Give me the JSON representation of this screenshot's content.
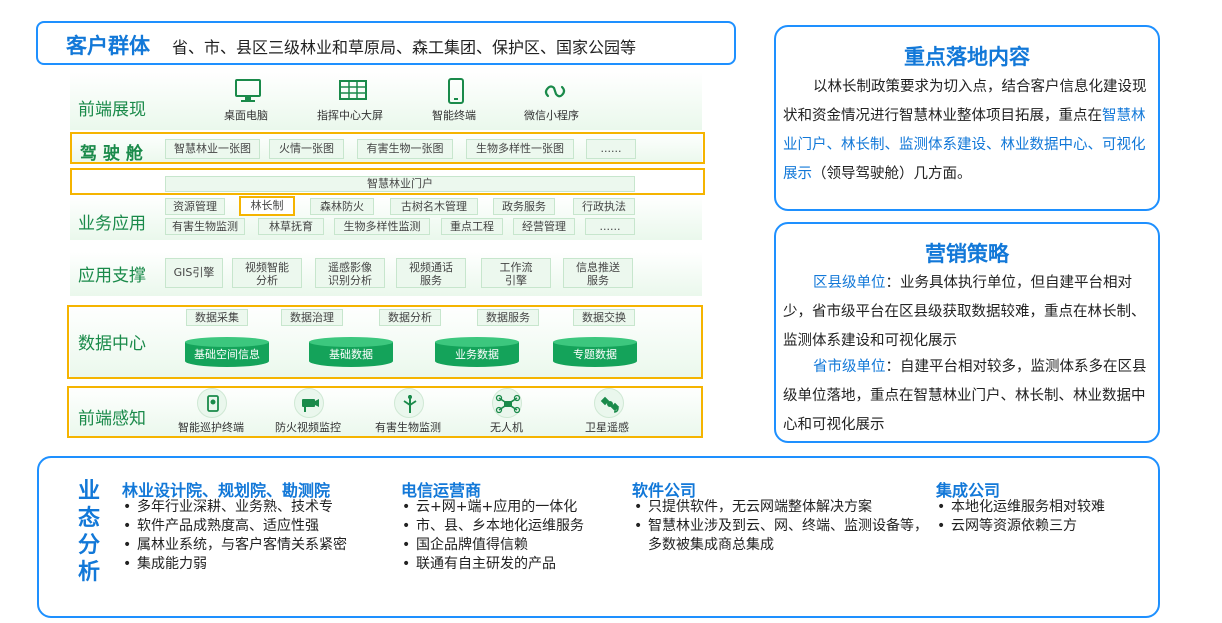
{
  "customer": {
    "title": "客户群体",
    "text": "省、市、县区三级林业和草原局、森工集团、保护区、国家公园等"
  },
  "layers": {
    "frontend_display": {
      "label": "前端展现",
      "items": [
        "桌面电脑",
        "指挥中心大屏",
        "智能终端",
        "微信小程序"
      ],
      "icons": [
        "monitor-icon",
        "big-screen-icon",
        "tablet-icon",
        "wechat-miniprogram-icon"
      ]
    },
    "cockpit": {
      "label": "驾 驶 舱",
      "items": [
        "智慧林业一张图",
        "火情一张图",
        "有害生物一张图",
        "生物多样性一张图",
        "......"
      ]
    },
    "portal": {
      "label": "智慧林业门户"
    },
    "business": {
      "label": "业务应用",
      "row1": [
        "资源管理",
        "林长制",
        "森林防火",
        "古树名木管理",
        "政务服务",
        "行政执法"
      ],
      "row2": [
        "有害生物监测",
        "林草抚育",
        "生物多样性监测",
        "重点工程",
        "经营管理",
        "......"
      ]
    },
    "support": {
      "label": "应用支撑",
      "items": [
        [
          "GIS引擎"
        ],
        [
          "视频智能",
          "分析"
        ],
        [
          "遥感影像",
          "识别分析"
        ],
        [
          "视频通话",
          "服务"
        ],
        [
          "工作流",
          "引擎"
        ],
        [
          "信息推送",
          "服务"
        ]
      ]
    },
    "data_center": {
      "label": "数据中心",
      "tools": [
        "数据采集",
        "数据治理",
        "数据分析",
        "数据服务",
        "数据交换"
      ],
      "stores": [
        "基础空间信息",
        "基础数据",
        "业务数据",
        "专题数据"
      ]
    },
    "sensing": {
      "label": "前端感知",
      "items": [
        "智能巡护终端",
        "防火视频监控",
        "有害生物监测",
        "无人机",
        "卫星遥感"
      ],
      "icons": [
        "patrol-terminal-icon",
        "camera-icon",
        "pest-monitor-icon",
        "drone-icon",
        "satellite-icon"
      ]
    }
  },
  "key_content": {
    "title": "重点落地内容",
    "p1": "以林长制政策要求为切入点，结合客户信息化建设现状和资金情况进行智慧林业整体项目拓展，重点在",
    "p1_blue": "智慧林业门户、林长制、监测体系建设、林业数据中心、可视化展示",
    "p1_end": "（领导驾驶舱）几方面。"
  },
  "marketing": {
    "title": "营销策略",
    "county_label": "区县级单位",
    "county_text": "：业务具体执行单位，但自建平台相对少，省市级平台在区县级获取数据较难，重点在林长制、监测体系建设和可视化展示",
    "province_label": "省市级单位",
    "province_text": "：自建平台相对较多，监测体系多在区县级单位落地，重点在智慧林业门户、林长制、林业数据中心和可视化展示"
  },
  "industry": {
    "title": "业态分析",
    "title_chars": [
      "业",
      "态",
      "分",
      "析"
    ],
    "groups": [
      {
        "name": "林业设计院、规划院、勘测院",
        "points": [
          "多年行业深耕、业务熟、技术专",
          "软件产品成熟度高、适应性强",
          "属林业系统，与客户客情关系紧密",
          "集成能力弱"
        ]
      },
      {
        "name": "电信运营商",
        "points": [
          "云+网+端+应用的一体化",
          "市、县、乡本地化运维服务",
          "国企品牌值得信赖",
          "联通有自主研发的产品"
        ]
      },
      {
        "name": "软件公司",
        "points": [
          "只提供软件，无云网端整体解决方案",
          "智慧林业涉及到云、网、终端、监测设备等，多数被集成商总集成"
        ]
      },
      {
        "name": "集成公司",
        "points": [
          "本地化运维服务相对较难",
          "云网等资源依赖三方"
        ]
      }
    ]
  },
  "colors": {
    "accent_blue": "#1278d8",
    "green": "#1a8a4a",
    "highlight": "#f5b400"
  }
}
